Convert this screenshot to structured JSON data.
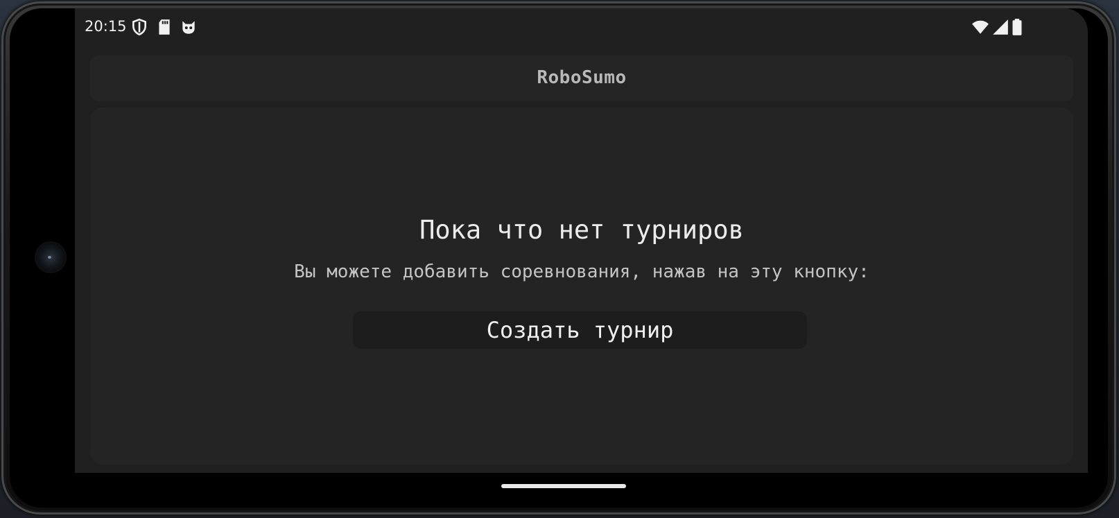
{
  "status_bar": {
    "time": "20:15",
    "left_icons": [
      "shield-icon",
      "sd-card-icon",
      "cat-face-icon"
    ],
    "right_icons": [
      "wifi-icon",
      "signal-icon",
      "battery-icon"
    ]
  },
  "app_bar": {
    "title": "RoboSumo"
  },
  "empty_state": {
    "title": "Пока что нет турниров",
    "subtitle": "Вы можете добавить соревнования, нажав на эту кнопку:",
    "button_label": "Создать турнир"
  },
  "colors": {
    "background": "#202020",
    "card": "#242424",
    "button": "#1d1d1d",
    "text_primary": "#ececec",
    "text_secondary": "#c4c4c4"
  }
}
